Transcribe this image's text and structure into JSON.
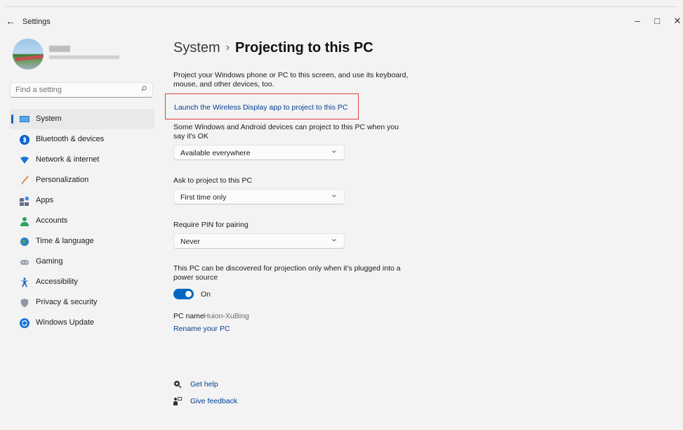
{
  "window": {
    "title": "Settings",
    "back_glyph": "←",
    "minimize_glyph": "–",
    "maximize_glyph": "□",
    "close_glyph": "✕"
  },
  "search": {
    "placeholder": "Find a setting"
  },
  "sidebar": {
    "items": [
      {
        "label": "System",
        "icon": "system-icon",
        "active": true
      },
      {
        "label": "Bluetooth & devices",
        "icon": "bluetooth-icon"
      },
      {
        "label": "Network & internet",
        "icon": "network-icon"
      },
      {
        "label": "Personalization",
        "icon": "personalization-icon"
      },
      {
        "label": "Apps",
        "icon": "apps-icon"
      },
      {
        "label": "Accounts",
        "icon": "accounts-icon"
      },
      {
        "label": "Time & language",
        "icon": "time-language-icon"
      },
      {
        "label": "Gaming",
        "icon": "gaming-icon"
      },
      {
        "label": "Accessibility",
        "icon": "accessibility-icon"
      },
      {
        "label": "Privacy & security",
        "icon": "privacy-icon"
      },
      {
        "label": "Windows Update",
        "icon": "windows-update-icon"
      }
    ]
  },
  "main": {
    "breadcrumb_parent": "System",
    "breadcrumb_sep": "›",
    "breadcrumb_current": "Projecting to this PC",
    "description": "Project your Windows phone or PC to this screen, and use its keyboard, mouse, and other devices, too.",
    "launch_link": "Launch the Wireless Display app to project to this PC",
    "setting1_label": "Some Windows and Android devices can project to this PC when you say it's OK",
    "setting1_value": "Available everywhere",
    "setting2_label": "Ask to project to this PC",
    "setting2_value": "First time only",
    "setting3_label": "Require PIN for pairing",
    "setting3_value": "Never",
    "power_label": "This PC can be discovered for projection only when it's plugged into a power source",
    "toggle_state": "On",
    "pcname_label": "PC name",
    "pcname_value": "Huion-XuBing",
    "rename_link": "Rename your PC",
    "get_help": "Get help",
    "give_feedback": "Give feedback"
  },
  "colors": {
    "accent": "#0067c0",
    "link": "#003e92",
    "highlight_box": "#e04040",
    "background": "#f3f3f3"
  }
}
